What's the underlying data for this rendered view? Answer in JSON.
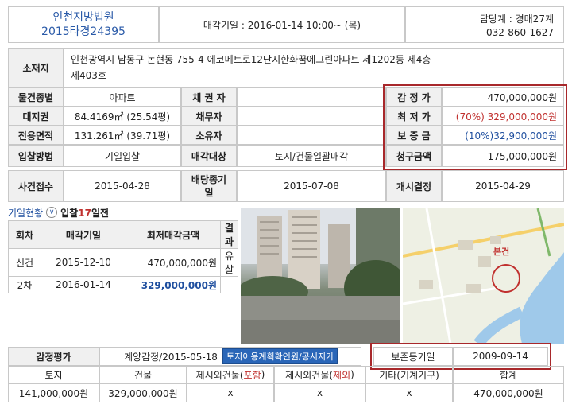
{
  "header": {
    "court": "인천지방법원",
    "case_no": "2015타경24395",
    "sale_date": "매각기일 : 2016-01-14   10:00~ (목)",
    "dept": "담당계 : 경매27계",
    "phone": "032-860-1627"
  },
  "address": {
    "label": "소재지",
    "value_line1": "인천광역시 남동구 논현동 755-4 에코메트로12단지한화꿈에그린아파트 제1202동 제4층",
    "value_line2": "제403호"
  },
  "rows": {
    "type_label": "물건종별",
    "type_value": "아파트",
    "creditor_label": "채 권 자",
    "creditor_value": "",
    "appraisal_label": "감 정 가",
    "appraisal_value": "470,000,000원",
    "land_label": "대지권",
    "land_value": "84.4169㎡ (25.54평)",
    "debtor_label": "채무자",
    "debtor_value": "",
    "min_label": "최 저 가",
    "min_value": "(70%) 329,000,000원",
    "area_label": "전용면적",
    "area_value": "131.261㎡ (39.71평)",
    "owner_label": "소유자",
    "owner_value": "",
    "deposit_label": "보 증 금",
    "deposit_value": "(10%)32,900,000원",
    "bid_label": "입찰방법",
    "bid_value": "기일입찰",
    "target_label": "매각대상",
    "target_value": "토지/건물일괄매각",
    "claim_label": "청구금액",
    "claim_value": "175,000,000원",
    "receipt_label": "사건접수",
    "receipt_value": "2015-04-28",
    "dividend_label_1": "배당종기",
    "dividend_label_2": "일",
    "dividend_value": "2015-07-08",
    "start_label": "개시결정",
    "start_value": "2015-04-29"
  },
  "history": {
    "title": "기일현황",
    "toggle": "∨",
    "bid_prefix": "입찰",
    "bid_days": "17",
    "bid_suffix": "일전",
    "columns": [
      "회차",
      "매각기일",
      "최저매각금액",
      "결과"
    ],
    "rows": [
      [
        "신건",
        "2015-12-10",
        "470,000,000원",
        "유찰"
      ],
      [
        "2차",
        "2016-01-14",
        "329,000,000원",
        ""
      ]
    ]
  },
  "map": {
    "marker_label": "본건"
  },
  "appraisal": {
    "label": "감정평가",
    "value": "계양감정/2015-05-18",
    "button": "토지이용계획확인원/공시지가",
    "reg_label": "보존등기일",
    "reg_value": "2009-09-14"
  },
  "breakdown": {
    "headers": [
      "토지",
      "건물",
      "제시외건물(",
      "포함",
      ")",
      "제시외건물(",
      "제외",
      ")",
      "기타(기계기구)",
      "합계"
    ],
    "values": [
      "141,000,000원",
      "329,000,000원",
      "x",
      "x",
      "x",
      "470,000,000원"
    ]
  }
}
